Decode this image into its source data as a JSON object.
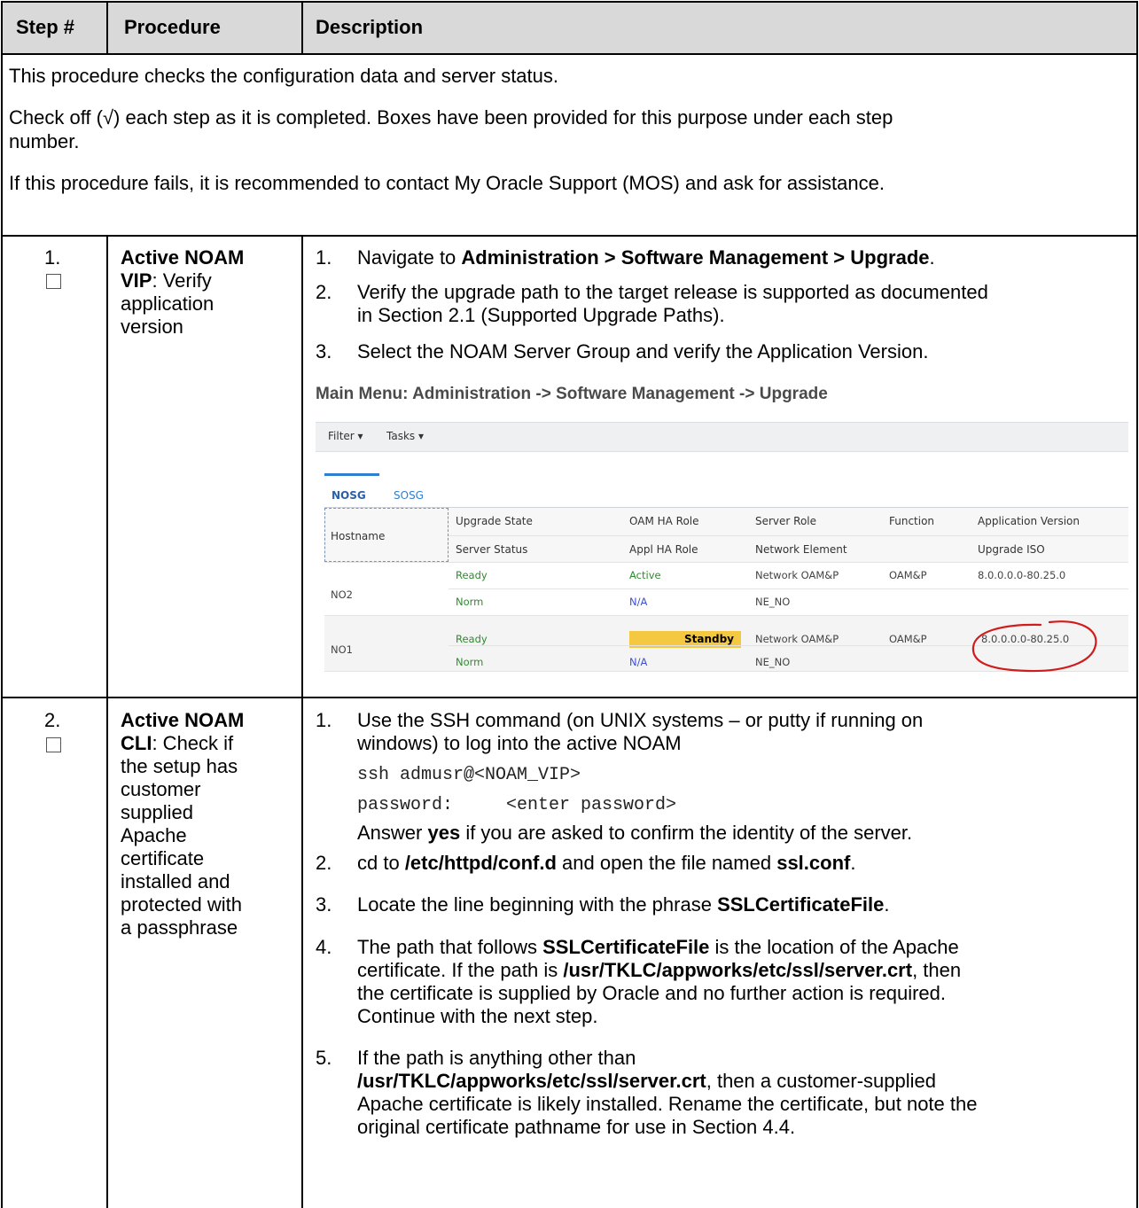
{
  "header": {
    "step_col": "Step #",
    "procedure_col": "Procedure",
    "description_col": "Description"
  },
  "intro": {
    "line1": "This procedure checks the configuration data and server status.",
    "line2a": "Check off (√) each step as it is completed.  Boxes have been provided for this purpose under each step",
    "line2b": "number.",
    "line3": "If this procedure fails, it is recommended to contact My Oracle Support (MOS) and ask for assistance."
  },
  "step1": {
    "num": "1.",
    "title_bold_a": "Active NOAM",
    "title_bold_b": "VIP",
    "title_rest_b": ": Verify",
    "title_c": "application",
    "title_d": "version",
    "items": {
      "i1_num": "1.",
      "i1_pre": "Navigate to ",
      "i1_bold": "Administration > Software Management > Upgrade",
      "i1_post": ".",
      "i2_num": "2.",
      "i2_a": "Verify the upgrade path to the target release is supported as documented",
      "i2_b": "in Section 2.1 (Supported Upgrade Paths).",
      "i3_num": "3.",
      "i3": "Select the NOAM Server Group and verify the Application Version."
    },
    "screenshot": {
      "title": "Main Menu: Administration -> Software Management -> Upgrade",
      "filter": "Filter  ▾",
      "tasks": "Tasks  ▾",
      "tabs": [
        "NOSG",
        "SOSG"
      ],
      "columns": {
        "hostname": "Hostname",
        "upgrade_state": "Upgrade State",
        "server_status": "Server Status",
        "oam_ha_role": "OAM HA Role",
        "appl_ha_role": "Appl HA Role",
        "server_role": "Server Role",
        "network_element": "Network Element",
        "function": "Function",
        "application_version": "Application Version",
        "upgrade_iso": "Upgrade ISO"
      },
      "rows": [
        {
          "hostname": "NO2",
          "upgrade_state": "Ready",
          "server_status": "Norm",
          "oam_ha_role": "Active",
          "appl_ha_role": "N/A",
          "server_role": "Network OAM&P",
          "network_element": "NE_NO",
          "function": "OAM&P",
          "application_version": "8.0.0.0.0-80.25.0",
          "upgrade_iso": ""
        },
        {
          "hostname": "NO1",
          "upgrade_state": "Ready",
          "server_status": "Norm",
          "oam_ha_role": "Standby",
          "appl_ha_role": "N/A",
          "server_role": "Network OAM&P",
          "network_element": "NE_NO",
          "function": "OAM&P",
          "application_version": "8.0.0.0.0-80.25.0",
          "upgrade_iso": ""
        }
      ]
    }
  },
  "step2": {
    "num": "2.",
    "title_bold_a": "Active NOAM",
    "title_bold_b": "CLI",
    "title_rest_b": ": Check if",
    "title_c": "the setup has",
    "title_d": "customer",
    "title_e": "supplied",
    "title_f": "Apache",
    "title_g": "certificate",
    "title_h": "installed and",
    "title_i": "protected with",
    "title_j": "a passphrase",
    "items": {
      "i1_num": "1.",
      "i1_a": "Use the SSH command (on UNIX systems – or putty if running on",
      "i1_b": "windows) to log into the active NOAM",
      "cmd1": "ssh admusr@<NOAM_VIP>",
      "cmd2_label": "password:",
      "cmd2_value": "<enter password>",
      "answer_pre": "Answer ",
      "answer_bold": "yes",
      "answer_post": " if you are asked to confirm the identity of the server.",
      "i2_num": "2.",
      "i2_pre": "cd to ",
      "i2_bold1": "/etc/httpd/conf.d",
      "i2_mid": " and open the file named ",
      "i2_bold2": "ssl.conf",
      "i2_post": ".",
      "i3_num": "3.",
      "i3_pre": "Locate the line beginning with the phrase ",
      "i3_bold": "SSLCertificateFile",
      "i3_post": ".",
      "i4_num": "4.",
      "i4_a_pre": "The path that follows ",
      "i4_a_bold": "SSLCertificateFile",
      "i4_a_post": " is the location of the Apache",
      "i4_b_pre": "certificate.  If the path is ",
      "i4_b_bold": "/usr/TKLC/appworks/etc/ssl/server.crt",
      "i4_b_post": ", then",
      "i4_c": "the certificate is supplied by Oracle and no further action is required.",
      "i4_d": "Continue with the next step.",
      "i5_num": "5.",
      "i5_a": "If the path is anything other than",
      "i5_b_bold": "/usr/TKLC/appworks/etc/ssl/server.crt",
      "i5_b_post": ", then a customer-supplied",
      "i5_c": "Apache certificate is likely installed.  Rename the certificate, but note the",
      "i5_d": "original certificate pathname for use in Section 4.4."
    }
  }
}
